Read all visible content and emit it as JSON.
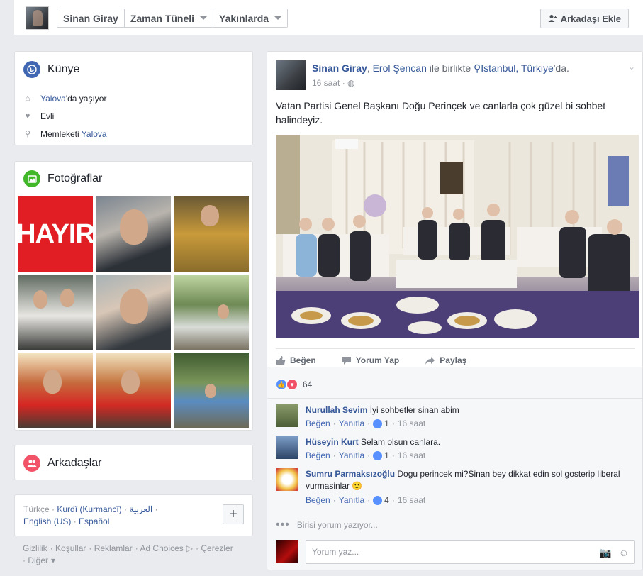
{
  "topbar": {
    "tabs": [
      {
        "label": "Sinan Giray"
      },
      {
        "label": "Zaman Tüneli"
      },
      {
        "label": "Yakınlarda"
      }
    ],
    "add_friend": "Arkadaşı Ekle"
  },
  "intro": {
    "title": "Künye",
    "rows": [
      {
        "icon": "home-icon",
        "link": "Yalova",
        "text": "'da yaşıyor"
      },
      {
        "icon": "heart-icon",
        "text": "Evli"
      },
      {
        "icon": "location-pin-icon",
        "prefix": "Memleketi ",
        "link": "Yalova"
      }
    ]
  },
  "photos": {
    "title": "Fotoğraflar",
    "tile1_text": "HAYIR"
  },
  "friends": {
    "title": "Arkadaşlar"
  },
  "languages": {
    "items": [
      "Türkçe",
      "Kurdî (Kurmancî)",
      "العربية",
      "English (US)",
      "Español"
    ],
    "add": "+"
  },
  "footer": {
    "links": [
      "Gizlilik",
      "Koşullar",
      "Reklamlar",
      "Ad Choices",
      "Çerezler",
      "Diğer"
    ]
  },
  "post": {
    "author": "Sinan Giray",
    "tagged": "Erol Şencan",
    "with": "ile birlikte",
    "place": "Istanbul, Türkiye",
    "place_suffix": "'da.",
    "time": "16 saat",
    "text": "Vatan Partisi Genel Başkanı Doğu Perinçek ve canlarla çok güzel bi sohbet halindeyiz.",
    "actions": [
      "Beğen",
      "Yorum Yap",
      "Paylaş"
    ],
    "reaction_count": "64"
  },
  "comments": [
    {
      "name": "Nurullah Sevim",
      "text": "İyi sohbetler sinan abim",
      "like": "Beğen",
      "reply": "Yanıtla",
      "likes": "1",
      "time": "16 saat",
      "avatar_color": "#5b6b45"
    },
    {
      "name": "Hüseyin Kurt",
      "text": "Selam olsun canlara.",
      "like": "Beğen",
      "reply": "Yanıtla",
      "likes": "1",
      "time": "16 saat",
      "avatar_color": "#3c5f8a"
    },
    {
      "name": "Sumru Parmaksızoğlu",
      "text": "Dogu perincek mi?Sinan bey dikkat edin sol gosterip liberal vurmasinlar 🙂",
      "like": "Beğen",
      "reply": "Yanıtla",
      "likes": "4",
      "time": "16 saat",
      "avatar_color": "#f3c34a"
    }
  ],
  "typing": "Birisi yorum yazıyor...",
  "reply_placeholder": "Yorum yaz..."
}
